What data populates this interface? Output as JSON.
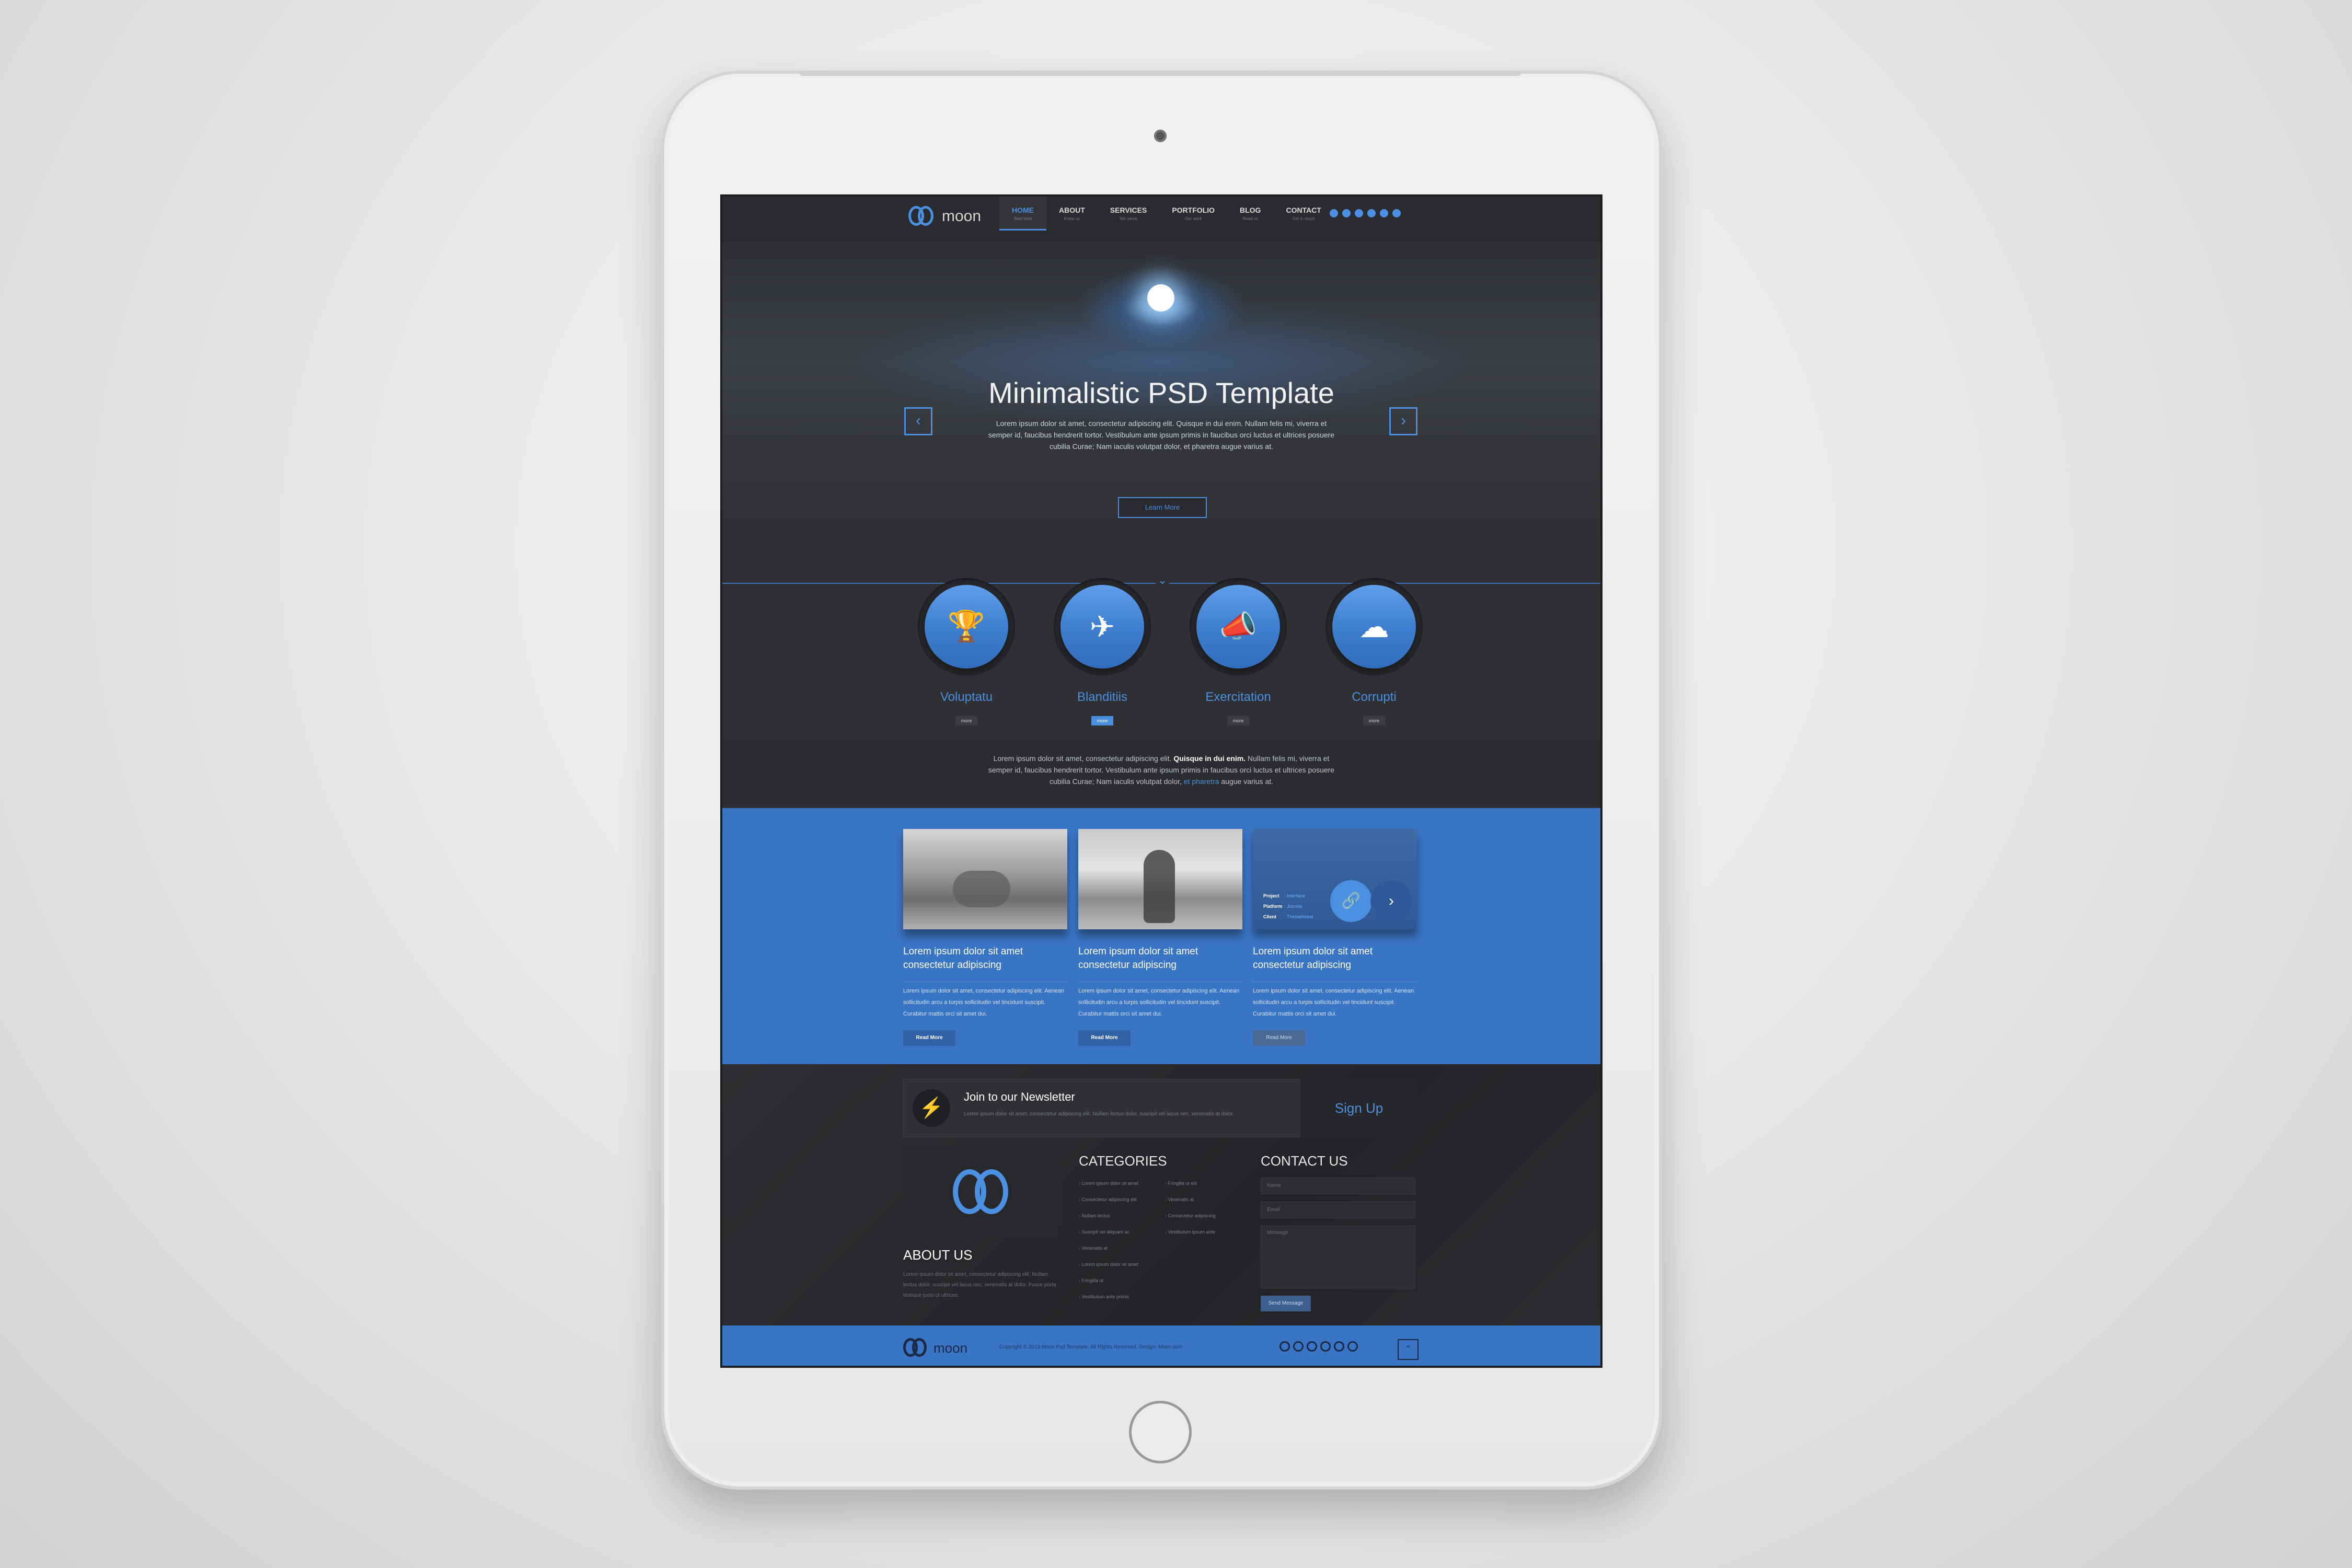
{
  "header": {
    "logo_text": "moon",
    "nav": [
      {
        "label": "HOME",
        "sub": "Start here"
      },
      {
        "label": "ABOUT",
        "sub": "Know us"
      },
      {
        "label": "SERVICES",
        "sub": "We serve"
      },
      {
        "label": "PORTFOLIO",
        "sub": "Our work"
      },
      {
        "label": "BLOG",
        "sub": "Read us"
      },
      {
        "label": "CONTACT",
        "sub": "Get in touch"
      }
    ],
    "active_nav": "HOME"
  },
  "hero": {
    "title": "Minimalistic PSD Template",
    "text": "Lorem ipsum dolor sit amet, consectetur adipiscing elit. Quisque in dui enim. Nullam felis mi, viverra et semper id, faucibus hendrerit tortor. Vestibulum ante ipsum primis in faucibus orci luctus et ultrices posuere cubilia Curae; Nam iaculis volutpat dolor, et pharetra augue varius at.",
    "button": "Learn More",
    "prev": "‹",
    "next": "›",
    "down": "⌄"
  },
  "features": [
    {
      "title": "Voluptatu",
      "more": "more",
      "icon": "trophy-icon",
      "glyph": "🏆"
    },
    {
      "title": "Blanditiis",
      "more": "more",
      "icon": "airplane-icon",
      "glyph": "✈"
    },
    {
      "title": "Exercitation",
      "more": "more",
      "icon": "megaphone-icon",
      "glyph": "📣"
    },
    {
      "title": "Corrupti",
      "more": "more",
      "icon": "cloud-icon",
      "glyph": "☁"
    }
  ],
  "intro": {
    "text_before": "Lorem ipsum dolor sit amet, consectetur adipiscing elit. ",
    "bold": "Quisque in dui enim.",
    "text_after": " Nullam felis mi, viverra et semper id, faucibus hendrerit tortor. Vestibulum ante ipsum primis in faucibus orci luctus et ultrices posuere cubilia Curae; Nam iaculis volutpat dolor, ",
    "link": "et pharetra",
    "text_end": " augue varius at."
  },
  "portfolio": {
    "cards": [
      {
        "title": "Lorem ipsum dolor sit amet consectetur adipiscing",
        "text": "Lorem ipsum dolor sit amet, consectetur adipiscing elit. Aenean sollicitudin arcu a turpis sollicitudin vel tincidunt suscipit. Curabitur mattis orci sit amet dui.",
        "button": "Read More"
      },
      {
        "title": "Lorem ipsum dolor sit amet consectetur adipiscing",
        "text": "Lorem ipsum dolor sit amet, consectetur adipiscing elit. Aenean sollicitudin arcu a turpis sollicitudin vel tincidunt suscipit. Curabitur mattis orci sit amet dui.",
        "button": "Read More"
      },
      {
        "title": "Lorem ipsum dolor sit amet consectetur adipiscing",
        "text": "Lorem ipsum dolor sit amet, consectetur adipiscing elit. Aenean sollicitudin arcu a turpis sollicitudin vel tincidunt suscipit. Curabitur mattis orci sit amet dui.",
        "button": "Read More"
      }
    ],
    "overlay": {
      "project_label": "Project",
      "project_value": ": Interface",
      "platform_label": "Platform",
      "platform_value": ": Joomla",
      "client_label": "Client",
      "client_value": ": Themeforest",
      "link_glyph": "🔗",
      "next_glyph": "›"
    }
  },
  "newsletter": {
    "title": "Join to our Newsletter",
    "text": "Lorem ipsum dolor sit amet, consectetur adipiscing elit. Nullam lectus dolor, suscipit vel lacus nec, venenatis at dolor.",
    "signup": "Sign Up",
    "icon_glyph": "⚡"
  },
  "about": {
    "title": "ABOUT US",
    "text": "Lorem ipsum dolor sit amet, consectetur adipiscing elit. Nullam lectus dolor, suscipit vel lacus nec, venenatis at dolor. Fusce porta tristique justo ut ultrices."
  },
  "categories": {
    "title": "CATEGORIES",
    "col1": [
      "Lorem ipsum dolor sit amet",
      "Consectetur adipiscing elit",
      "Nullam lectus",
      "Suscipit vel aliquam ac",
      "Venenatis at",
      "Lorem ipsum dolor sit amet",
      "Fringilla ut",
      "Vestibulum ante primis"
    ],
    "col2": [
      "Fringilla ut elit",
      "Venenatis at",
      "Consectetur adipiscing",
      "Vestibulum ipsum ante"
    ]
  },
  "contact": {
    "title": "CONTACT US",
    "name_ph": "Name",
    "email_ph": "Email",
    "message_ph": "Message",
    "send": "Send Message"
  },
  "footer": {
    "logo_text": "moon",
    "copyright": "Copyright © 2013 Moon Psd Template. All Rights Reserved. Design: Moon.com",
    "totop": "⌃"
  },
  "colors": {
    "accent": "#4a8fe0",
    "band": "#3a74c4",
    "dark": "#2f3033"
  }
}
